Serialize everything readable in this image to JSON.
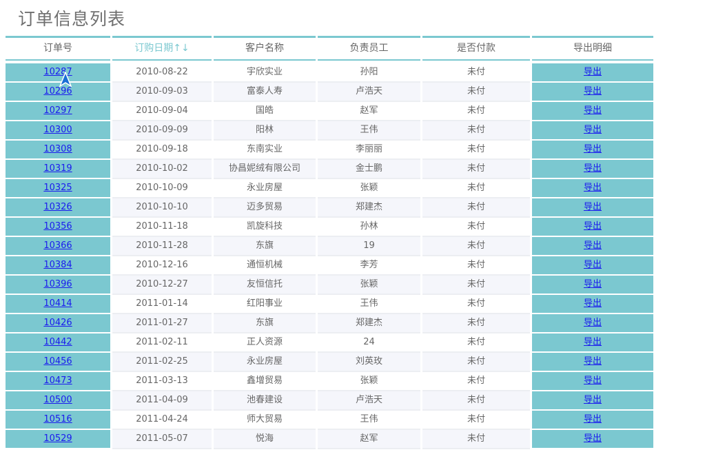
{
  "page": {
    "title": "订单信息列表"
  },
  "colors": {
    "accent": "#7bc8d0",
    "link": "#1a1aee",
    "row_alt": "#f5f6fb"
  },
  "table": {
    "headers": [
      "订单号",
      "订购日期↑↓",
      "客户名称",
      "负责员工",
      "是否付款",
      "导出明细"
    ],
    "sorted_column": "订购日期",
    "export_label": "导出",
    "rows": [
      [
        "10287",
        "2010-08-22",
        "宇欣实业",
        "孙阳",
        "未付"
      ],
      [
        "10296",
        "2010-09-03",
        "富泰人寿",
        "卢浩天",
        "未付"
      ],
      [
        "10297",
        "2010-09-04",
        "国皓",
        "赵军",
        "未付"
      ],
      [
        "10300",
        "2010-09-09",
        "阳林",
        "王伟",
        "未付"
      ],
      [
        "10308",
        "2010-09-18",
        "东南实业",
        "李丽丽",
        "未付"
      ],
      [
        "10319",
        "2010-10-02",
        "协昌妮绒有限公司",
        "金士鹏",
        "未付"
      ],
      [
        "10325",
        "2010-10-09",
        "永业房屋",
        "张颖",
        "未付"
      ],
      [
        "10326",
        "2010-10-10",
        "迈多贸易",
        "郑建杰",
        "未付"
      ],
      [
        "10356",
        "2010-11-18",
        "凯旋科技",
        "孙林",
        "未付"
      ],
      [
        "10366",
        "2010-11-28",
        "东旗",
        "19",
        "未付"
      ],
      [
        "10384",
        "2010-12-16",
        "通恒机械",
        "李芳",
        "未付"
      ],
      [
        "10396",
        "2010-12-27",
        "友恒信托",
        "张颖",
        "未付"
      ],
      [
        "10414",
        "2011-01-14",
        "红阳事业",
        "王伟",
        "未付"
      ],
      [
        "10426",
        "2011-01-27",
        "东旗",
        "郑建杰",
        "未付"
      ],
      [
        "10442",
        "2011-02-11",
        "正人资源",
        "24",
        "未付"
      ],
      [
        "10456",
        "2011-02-25",
        "永业房屋",
        "刘英玫",
        "未付"
      ],
      [
        "10473",
        "2011-03-13",
        "鑫增贸易",
        "张颖",
        "未付"
      ],
      [
        "10500",
        "2011-04-09",
        "池春建设",
        "卢浩天",
        "未付"
      ],
      [
        "10516",
        "2011-04-24",
        "师大贸易",
        "王伟",
        "未付"
      ],
      [
        "10529",
        "2011-05-07",
        "悦海",
        "赵军",
        "未付"
      ]
    ]
  }
}
